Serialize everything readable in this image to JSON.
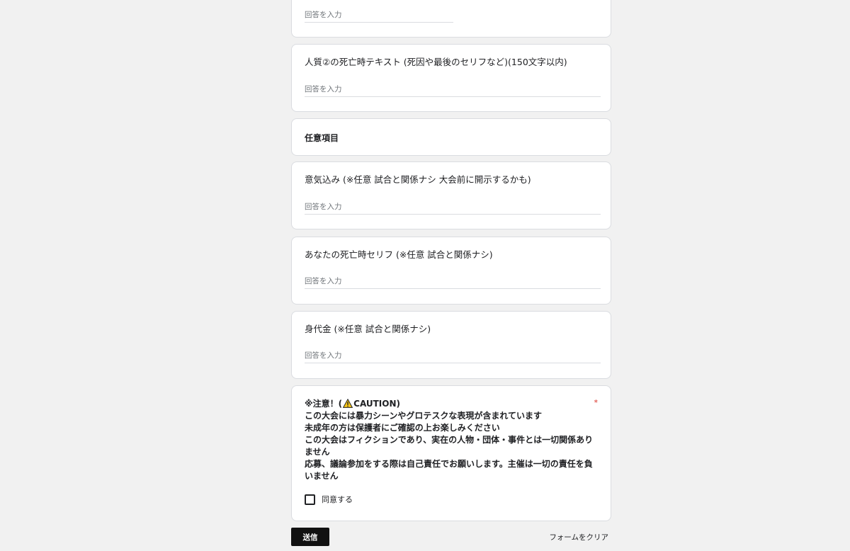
{
  "form": {
    "placeholder": "回答を入力",
    "questions": [
      {
        "title": ""
      },
      {
        "title": "人質②の死亡時テキスト (死因や最後のセリフなど)(150文字以内)"
      },
      {
        "title": "意気込み (※任意 試合と関係ナシ 大会前に開示するかも)"
      },
      {
        "title": "あなたの死亡時セリフ (※任意 試合と関係ナシ)"
      },
      {
        "title": "身代金 (※任意 試合と関係ナシ)"
      }
    ],
    "section": {
      "title": "任意項目"
    },
    "caution": {
      "line1_prefix": "※注意！(",
      "line1_suffix": "CAUTION)",
      "lines": [
        "この大会には暴力シーンやグロテスクな表現が含まれています",
        "未成年の方は保護者にご確認の上お楽しみください",
        "この大会はフィクションであり、実在の人物・団体・事件とは一切関係ありません",
        "応募、議論参加をする際は自己責任でお願いします。主催は一切の責任を負いません"
      ],
      "required_mark": "*",
      "checkbox_label": "同意する",
      "icon": "warning-icon"
    },
    "submit_label": "送信",
    "clear_label": "フォームをクリア"
  }
}
